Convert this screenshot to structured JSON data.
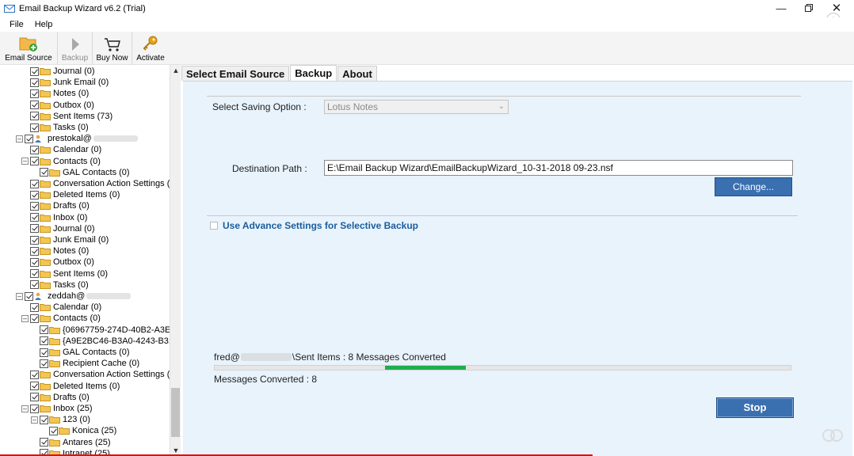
{
  "window": {
    "title": "Email Backup Wizard v6.2 (Trial)"
  },
  "menu": [
    {
      "label": "File"
    },
    {
      "label": "Help"
    }
  ],
  "toolbar": {
    "email_source": "Email Source",
    "backup": "Backup",
    "buy_now": "Buy Now",
    "activate": "Activate"
  },
  "tree": {
    "rows": [
      {
        "label": "Journal (0)",
        "indent": 1
      },
      {
        "label": "Junk Email (0)",
        "indent": 1
      },
      {
        "label": "Notes (0)",
        "indent": 1
      },
      {
        "label": "Outbox (0)",
        "indent": 1
      },
      {
        "label": "Sent Items (73)",
        "indent": 1
      },
      {
        "label": "Tasks (0)",
        "indent": 1
      },
      {
        "label": "prestokal@",
        "indent": 0,
        "account": true
      },
      {
        "label": "Calendar (0)",
        "indent": 1
      },
      {
        "label": "Contacts (0)",
        "indent": 1,
        "expander": true
      },
      {
        "label": "GAL Contacts (0)",
        "indent": 2
      },
      {
        "label": "Conversation Action Settings (0",
        "indent": 1
      },
      {
        "label": "Deleted Items (0)",
        "indent": 1
      },
      {
        "label": "Drafts (0)",
        "indent": 1
      },
      {
        "label": "Inbox (0)",
        "indent": 1
      },
      {
        "label": "Journal (0)",
        "indent": 1
      },
      {
        "label": "Junk Email (0)",
        "indent": 1
      },
      {
        "label": "Notes (0)",
        "indent": 1
      },
      {
        "label": "Outbox (0)",
        "indent": 1
      },
      {
        "label": "Sent Items (0)",
        "indent": 1
      },
      {
        "label": "Tasks (0)",
        "indent": 1
      },
      {
        "label": "zeddah@",
        "indent": 0,
        "account": true
      },
      {
        "label": "Calendar (0)",
        "indent": 1
      },
      {
        "label": "Contacts (0)",
        "indent": 1,
        "expander": true
      },
      {
        "label": "{06967759-274D-40B2-A3EB-",
        "indent": 2
      },
      {
        "label": "{A9E2BC46-B3A0-4243-B315",
        "indent": 2
      },
      {
        "label": "GAL Contacts (0)",
        "indent": 2
      },
      {
        "label": "Recipient Cache (0)",
        "indent": 2
      },
      {
        "label": "Conversation Action Settings (0",
        "indent": 1
      },
      {
        "label": "Deleted Items (0)",
        "indent": 1
      },
      {
        "label": "Drafts (0)",
        "indent": 1
      },
      {
        "label": "Inbox (25)",
        "indent": 1,
        "expander": true
      },
      {
        "label": "123 (0)",
        "indent": 2,
        "expander": true
      },
      {
        "label": "Konica (25)",
        "indent": 3
      },
      {
        "label": "Antares (25)",
        "indent": 2
      },
      {
        "label": "Intranet (25)",
        "indent": 2
      }
    ]
  },
  "tabs": [
    {
      "label": "Select Email Source",
      "active": false
    },
    {
      "label": "Backup",
      "active": true
    },
    {
      "label": "About",
      "active": false
    }
  ],
  "backup": {
    "saving_option_label": "Select Saving Option :",
    "saving_option_value": "Lotus Notes",
    "destination_label": "Destination Path :",
    "destination_value": "E:\\Email Backup Wizard\\EmailBackupWizard_10-31-2018 09-23.nsf",
    "change_button": "Change...",
    "advance_settings": "Use Advance Settings for Selective Backup",
    "status_prefix": "fred@",
    "status_suffix": "\\Sent Items : 8 Messages Converted",
    "messages_converted": "Messages Converted : 8",
    "progress": 0.14,
    "stop_button": "Stop"
  }
}
